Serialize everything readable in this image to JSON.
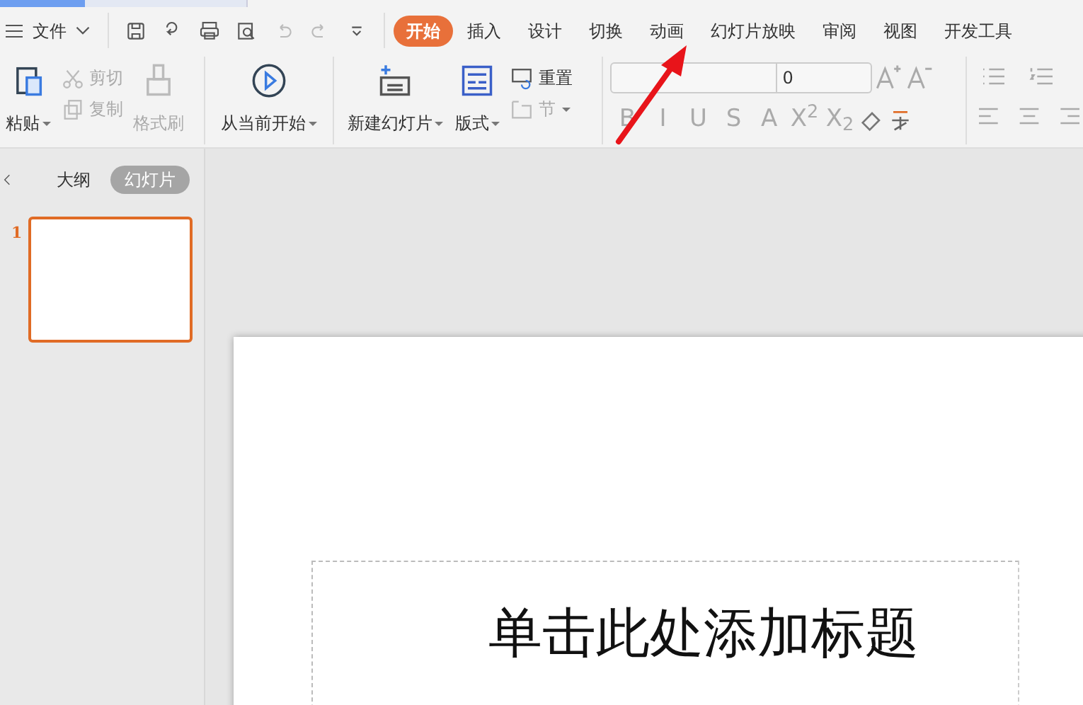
{
  "menu": {
    "label": "文件"
  },
  "tabs": [
    {
      "label": "开始",
      "selected": true
    },
    {
      "label": "插入",
      "selected": false
    },
    {
      "label": "设计",
      "selected": false
    },
    {
      "label": "切换",
      "selected": false
    },
    {
      "label": "动画",
      "selected": false
    },
    {
      "label": "幻灯片放映",
      "selected": false
    },
    {
      "label": "审阅",
      "selected": false
    },
    {
      "label": "视图",
      "selected": false
    },
    {
      "label": "开发工具",
      "selected": false
    }
  ],
  "clipboard": {
    "paste": {
      "label": "粘贴",
      "disabled": false,
      "dropdown": true
    },
    "cut": {
      "label": "剪切",
      "disabled": true
    },
    "copy": {
      "label": "复制",
      "disabled": true
    },
    "format_painter": {
      "label": "格式刷",
      "disabled": true
    }
  },
  "slideshow": {
    "label": "从当前开始",
    "dropdown": true
  },
  "slides_group": {
    "new_slide": {
      "label": "新建幻灯片",
      "dropdown": true
    },
    "layout": {
      "label": "版式",
      "dropdown": true
    },
    "reset": {
      "label": "重置",
      "disabled": false
    },
    "section": {
      "label": "节",
      "disabled": true,
      "dropdown": true
    }
  },
  "font": {
    "size": "0",
    "buttons": [
      "B",
      "I",
      "U",
      "S",
      "A",
      "X$^{2}$",
      "X$_{2}$"
    ],
    "disabled": true
  },
  "panel_tabs": [
    {
      "label": "大纲",
      "selected": false
    },
    {
      "label": "幻灯片",
      "selected": true
    }
  ],
  "slides": [
    {
      "number": "1",
      "selected": true
    }
  ],
  "slide": {
    "title_placeholder": "单击此处添加标题"
  }
}
